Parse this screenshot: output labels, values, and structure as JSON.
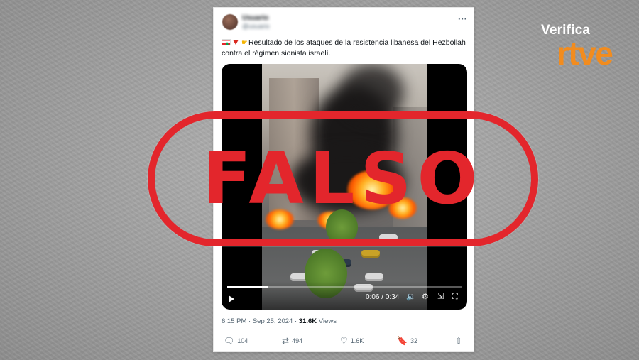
{
  "brand": {
    "line1": "Verifica",
    "line2": "rtve"
  },
  "tweet": {
    "author_name": "Usuario",
    "author_handle": "@usuario",
    "text": "Resultado de los ataques de la resistencia libanesa del Hezbollah contra el régimen sionista israelí.",
    "timestamp": "6:15 PM · Sep 25, 2024 · ",
    "views_count": "31.6K",
    "views_label": " Views",
    "icons": [
      "lebanon-flag-icon",
      "red-triangle-icon",
      "pointing-right-icon"
    ]
  },
  "video": {
    "time": "0:06 / 0:34",
    "progress": 0.176,
    "controls": [
      "play-icon",
      "volume-icon",
      "settings-icon",
      "expand-icon",
      "fullscreen-icon"
    ]
  },
  "stamp": {
    "text": "FALSO"
  },
  "actions": {
    "replies": "104",
    "reposts": "494",
    "likes": "1.6K",
    "bookmarks": "32"
  },
  "colors": {
    "stamp_red": "#e3262c",
    "rtve_orange": "#f28c1e"
  }
}
